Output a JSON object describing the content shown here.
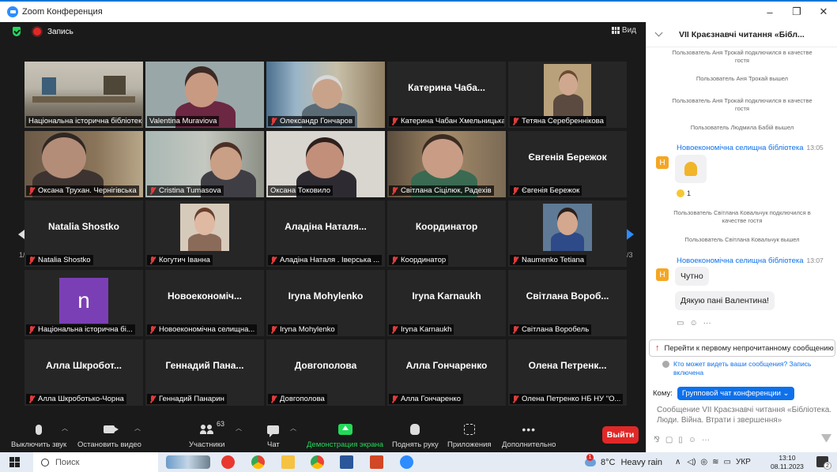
{
  "window": {
    "title": "Zoom Конференция",
    "controls": [
      "–",
      "❐",
      "✕"
    ]
  },
  "topbar": {
    "record_label": "Запись",
    "view_label": "Вид"
  },
  "tiles": [
    {
      "display": "photo",
      "label": "Національна історична бібліотека України",
      "muted": false,
      "active": true
    },
    {
      "display": "photo",
      "label": "Valentina Muraviova",
      "muted": false
    },
    {
      "display": "photo",
      "label": "Олександр Гончаров",
      "muted": true
    },
    {
      "display": "name",
      "center": "Катерина Чаба...",
      "label": "Катерина Чабан Хмельницька",
      "muted": true
    },
    {
      "display": "photo",
      "label": "Тетяна Серебреннікова",
      "muted": true
    },
    {
      "display": "photo",
      "label": "Оксана Трухан. Чернігівська",
      "muted": true
    },
    {
      "display": "photo",
      "label": "Cristina Tumasova",
      "muted": true
    },
    {
      "display": "photo",
      "label": "Оксана Токовило",
      "muted": false
    },
    {
      "display": "photo",
      "label": "Світлана Сіцілюк, Радехів",
      "muted": true
    },
    {
      "display": "name",
      "center": "Євгенія Бережок",
      "label": "Євгенія Бережок",
      "muted": true
    },
    {
      "display": "name",
      "center": "Natalia Shostko",
      "label": "Natalia Shostko",
      "muted": true
    },
    {
      "display": "photo",
      "label": "Когутич Іванна",
      "muted": true
    },
    {
      "display": "name",
      "center": "Аладіна Наталя...",
      "label": "Аладіна Наталя . Іверська ...",
      "muted": true
    },
    {
      "display": "name",
      "center": "Координатор",
      "label": "Координатор",
      "muted": true
    },
    {
      "display": "photo",
      "label": "Naumenko Tetiana",
      "muted": true
    },
    {
      "display": "avatar",
      "avatar_letter": "n",
      "label": "Національна історична бі...",
      "muted": true
    },
    {
      "display": "name",
      "center": "Новоекономіч...",
      "label": "Новоекономічна селищна...",
      "muted": true
    },
    {
      "display": "name",
      "center": "Iryna Mohylenko",
      "label": "Iryna Mohylenko",
      "muted": true
    },
    {
      "display": "name",
      "center": "Iryna Karnaukh",
      "label": "Iryna Karnaukh",
      "muted": true
    },
    {
      "display": "name",
      "center": "Світлана Вороб...",
      "label": "Світлана Воробель",
      "muted": true
    },
    {
      "display": "name",
      "center": "Алла Шкробот...",
      "label": "Алла Шкроботько-Чорна",
      "muted": true
    },
    {
      "display": "name",
      "center": "Геннадий Пана...",
      "label": "Геннадий Панарин",
      "muted": true
    },
    {
      "display": "name",
      "center": "Довгополова",
      "label": "Довгополова",
      "muted": true
    },
    {
      "display": "name",
      "center": "Алла Гончаренко",
      "label": "Алла Гончаренко",
      "muted": true
    },
    {
      "display": "name",
      "center": "Олена Петренк...",
      "label": "Олена Петренко НБ НУ \"О...",
      "muted": true
    }
  ],
  "pagination": {
    "left": "1/3",
    "right": "1/3"
  },
  "toolbar": {
    "mute_label": "Выключить звук",
    "video_label": "Остановить видео",
    "participants_label": "Участники",
    "participants_count": "63",
    "chat_label": "Чат",
    "share_label": "Демонстрация экрана",
    "raise_hand_label": "Поднять руку",
    "apps_label": "Приложения",
    "more_label": "Дополнительно",
    "exit_label": "Выйти"
  },
  "chat": {
    "title": "VII Краєзнавчі читання «Бібл...",
    "sys_messages": [
      "Пользователь Аня Трокай подключился в качестве гостя",
      "Пользователь Аня Трокай вышел",
      "Пользователь Аня Трокай подключился в качестве гостя",
      "Пользователь Людмила Бабій вышел",
      "Пользователь Світлана Ковальчук подключился в качестве гостя",
      "Пользователь Світлана Ковальчук вышел"
    ],
    "messages": [
      {
        "sender": "Новоекономічна селищна бібліотека",
        "time": "13:05",
        "avatar": "Н",
        "reaction_count": "1"
      },
      {
        "sender": "Новоекономічна селищна бібліотека",
        "time": "13:07",
        "avatar": "Н",
        "texts": [
          "Чутно",
          "Дякую пані Валентина!"
        ]
      }
    ],
    "jump_label": "Перейти к первому непрочитанному сообщению",
    "who_can_see": "Кто может видеть ваши сообщения? Запись включена",
    "to_label": "Кому:",
    "to_target": "Групповой чат конференции ⌄",
    "input_placeholder": "Сообщение VII Краєзнавчі читання «Бібліотека. Люди. Війна. Втрати і звершення»"
  },
  "taskbar": {
    "search_placeholder": "Поиск",
    "weather_temp": "8°C",
    "weather_desc": "Heavy rain",
    "lang": "УКР",
    "time": "13:10",
    "date": "08.11.2023",
    "weather_badge": "1",
    "notif_count": "2"
  }
}
